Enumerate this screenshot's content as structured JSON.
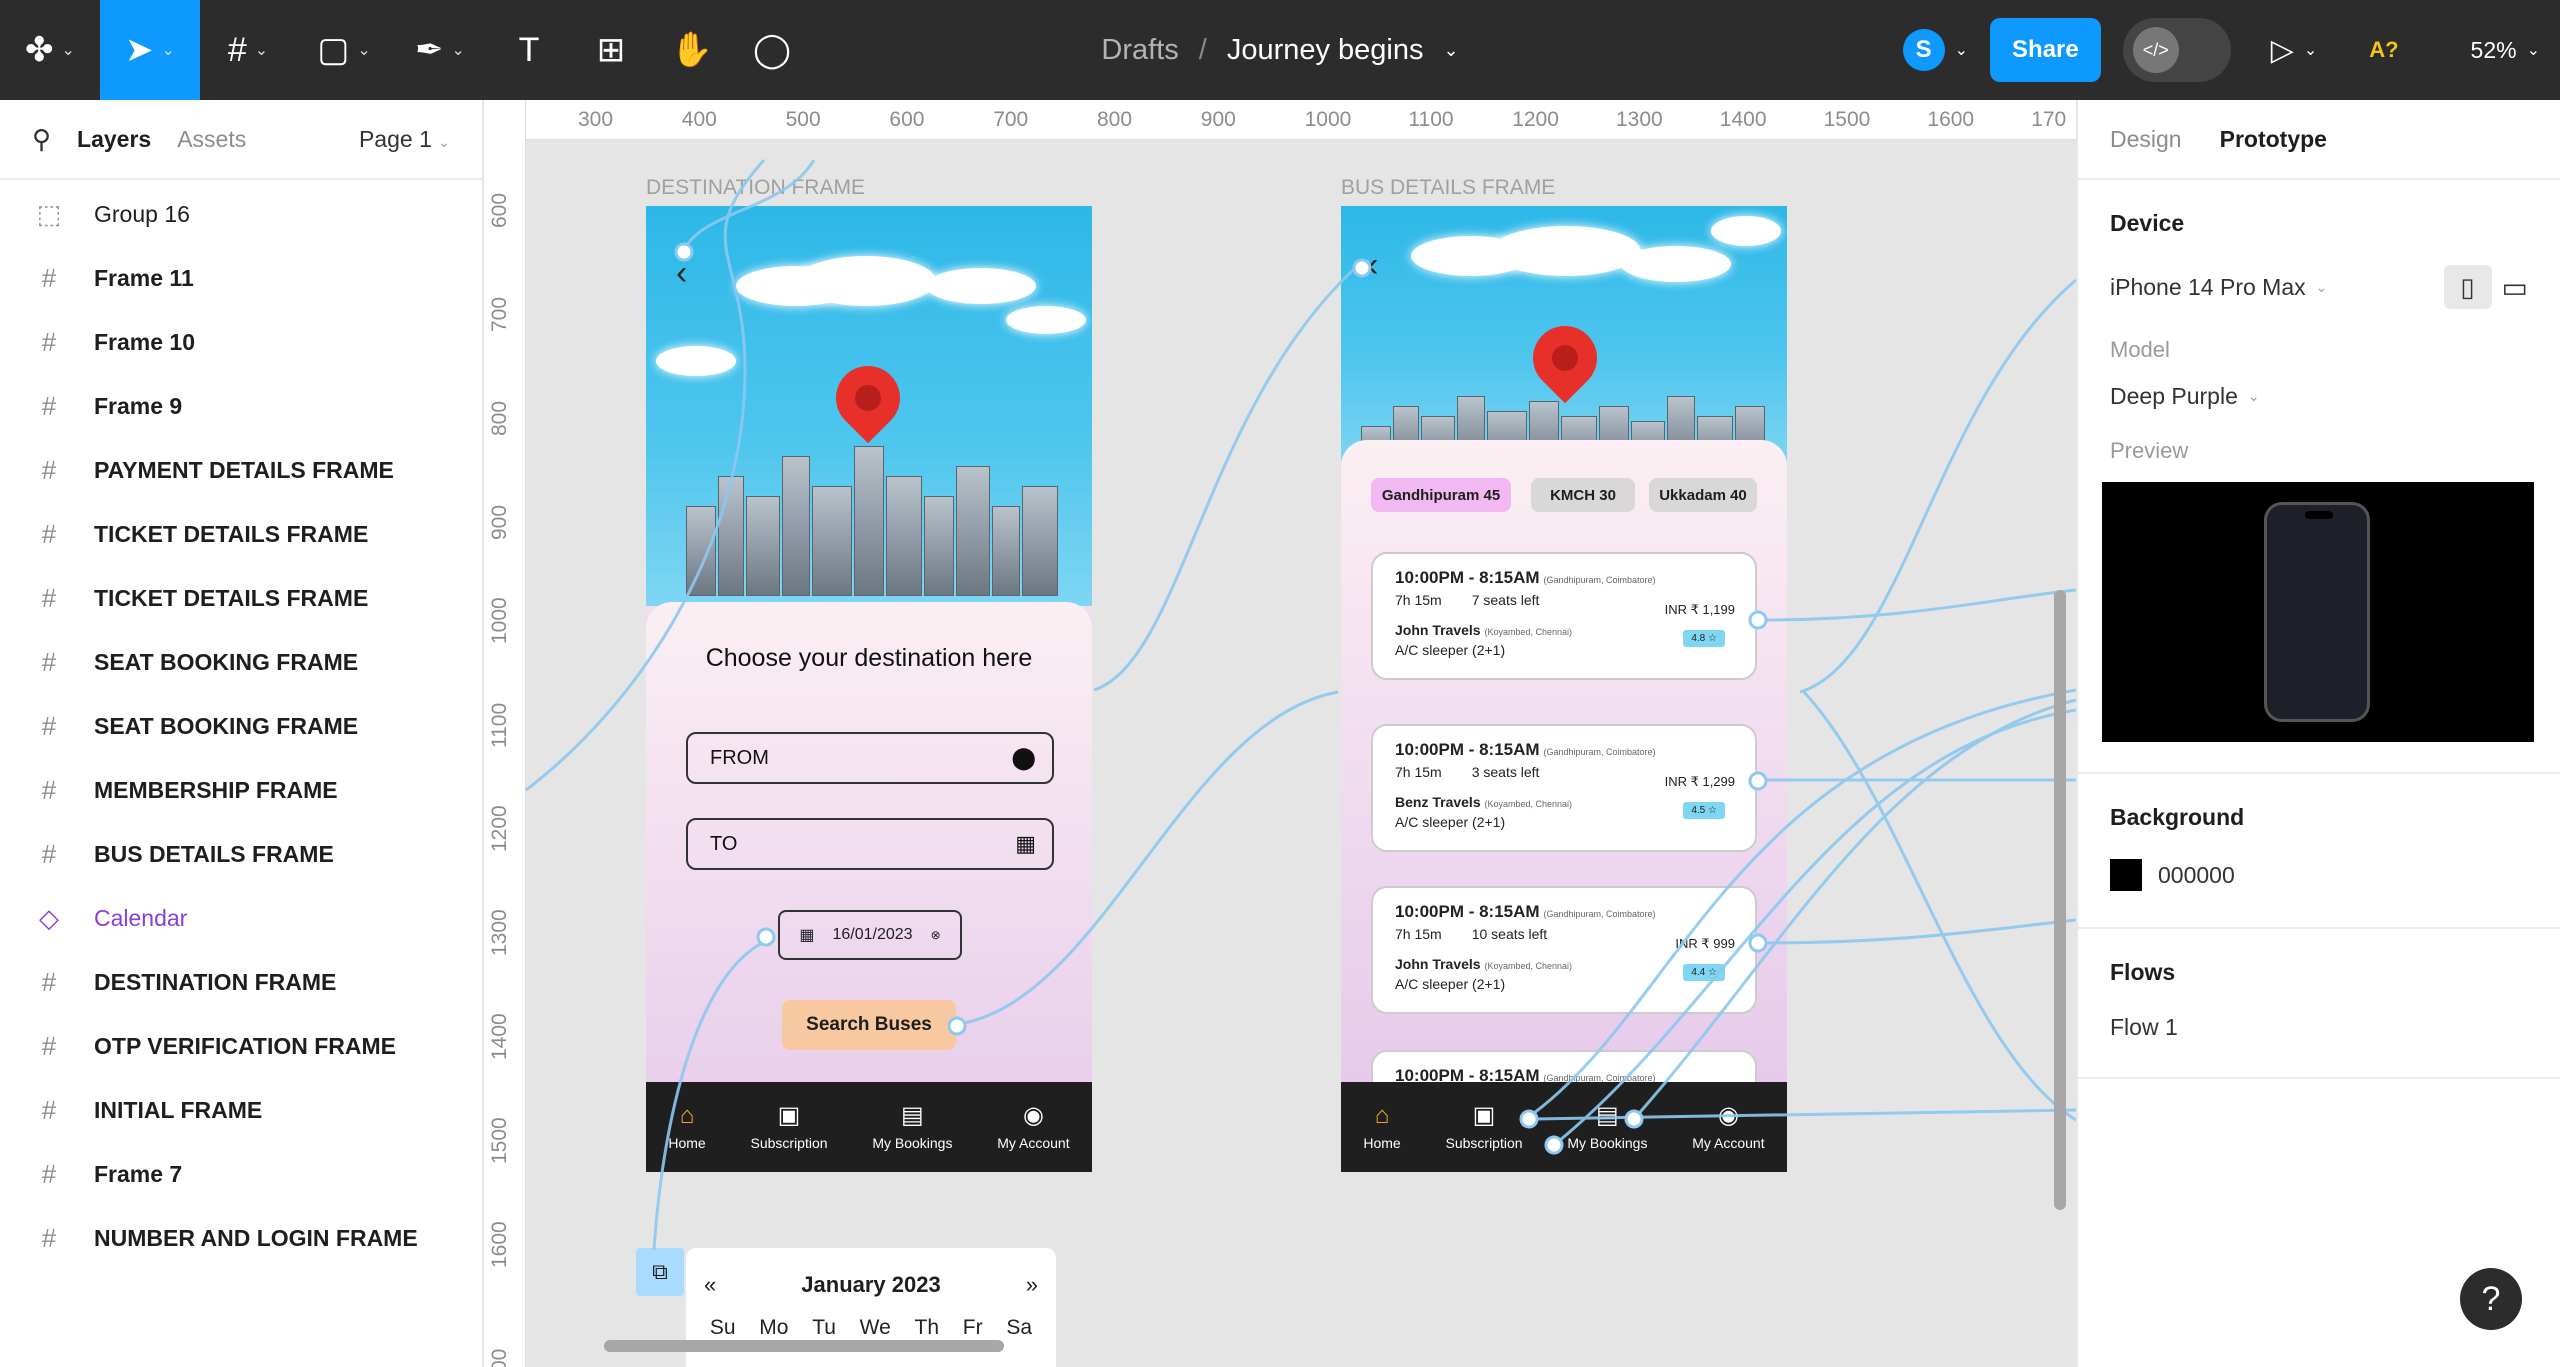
{
  "topbar": {
    "breadcrumb_parent": "Drafts",
    "breadcrumb_sep": "/",
    "file_name": "Journey begins",
    "avatar_initial": "S",
    "share_label": "Share",
    "dev_label": "</>",
    "zoom": "52%",
    "font_warning": "A?"
  },
  "layers_panel": {
    "tab_layers": "Layers",
    "tab_assets": "Assets",
    "page": "Page 1",
    "items": [
      {
        "label": "Group 16",
        "type": "group"
      },
      {
        "label": "Frame 11",
        "type": "frame"
      },
      {
        "label": "Frame 10",
        "type": "frame"
      },
      {
        "label": "Frame 9",
        "type": "frame"
      },
      {
        "label": "PAYMENT DETAILS FRAME",
        "type": "frame"
      },
      {
        "label": "TICKET DETAILS FRAME",
        "type": "frame"
      },
      {
        "label": "TICKET DETAILS FRAME",
        "type": "frame"
      },
      {
        "label": "SEAT BOOKING FRAME",
        "type": "frame"
      },
      {
        "label": "SEAT BOOKING FRAME",
        "type": "frame"
      },
      {
        "label": "MEMBERSHIP FRAME",
        "type": "frame"
      },
      {
        "label": "BUS DETAILS FRAME",
        "type": "frame"
      },
      {
        "label": "Calendar",
        "type": "component"
      },
      {
        "label": "DESTINATION FRAME",
        "type": "frame"
      },
      {
        "label": "OTP VERIFICATION FRAME",
        "type": "frame"
      },
      {
        "label": "INITIAL FRAME",
        "type": "frame"
      },
      {
        "label": "Frame 7",
        "type": "frame"
      },
      {
        "label": "NUMBER AND LOGIN FRAME",
        "type": "frame"
      }
    ]
  },
  "right_panel": {
    "tab_design": "Design",
    "tab_prototype": "Prototype",
    "device_title": "Device",
    "device_value": "iPhone 14 Pro Max",
    "model_label": "Model",
    "model_value": "Deep Purple",
    "preview_label": "Preview",
    "background_title": "Background",
    "background_value": "000000",
    "background_color": "#000000",
    "flows_title": "Flows",
    "flow_1": "Flow 1"
  },
  "canvas": {
    "ruler_top": [
      "300",
      "400",
      "500",
      "600",
      "700",
      "800",
      "900",
      "1000",
      "1100",
      "1200",
      "1300",
      "1400",
      "1500",
      "1600",
      "170"
    ],
    "ruler_left": [
      "600",
      "700",
      "800",
      "900",
      "1000",
      "1100",
      "1200",
      "1300",
      "1400",
      "1500",
      "1600",
      "00"
    ],
    "destination": {
      "label": "DESTINATION FRAME",
      "title": "Choose your destination here",
      "from_placeholder": "FROM",
      "to_placeholder": "TO",
      "date": "16/01/2023",
      "search_button": "Search Buses"
    },
    "bus_details": {
      "label": "BUS DETAILS FRAME",
      "chips": [
        "Gandhipuram 45",
        "KMCH  30",
        "Ukkadam 40"
      ],
      "buses": [
        {
          "time": "10:00PM - 8:15AM",
          "from": "(Gandhipuram, Coimbatore)",
          "duration": "7h 15m",
          "seats": "7 seats left",
          "operator": "John Travels",
          "to": "(Koyambed, Chennai)",
          "type": "A/C sleeper (2+1)",
          "price": "INR ₹ 1,199",
          "rating": "4.8 ☆"
        },
        {
          "time": "10:00PM - 8:15AM",
          "from": "(Gandhipuram, Coimbatore)",
          "duration": "7h 15m",
          "seats": "3 seats left",
          "operator": "Benz Travels",
          "to": "(Koyambed, Chennai)",
          "type": "A/C sleeper (2+1)",
          "price": "INR ₹ 1,299",
          "rating": "4.5 ☆"
        },
        {
          "time": "10:00PM - 8:15AM",
          "from": "(Gandhipuram, Coimbatore)",
          "duration": "7h 15m",
          "seats": "10 seats left",
          "operator": "John Travels",
          "to": "(Koyambed, Chennai)",
          "type": "A/C sleeper (2+1)",
          "price": "INR ₹ 999",
          "rating": "4.4 ☆"
        },
        {
          "time": "10:00PM - 8:15AM",
          "from": "(Gandhipuram, Coimbatore)",
          "duration": "",
          "seats": "",
          "operator": "",
          "to": "",
          "type": "",
          "price": "",
          "rating": ""
        }
      ]
    },
    "nav": [
      "Home",
      "Subscription",
      "My Bookings",
      "My Account"
    ],
    "calendar": {
      "month": "January 2023",
      "prev": "«",
      "next": "»",
      "days": [
        "Su",
        "Mo",
        "Tu",
        "We",
        "Th",
        "Fr",
        "Sa"
      ]
    }
  }
}
